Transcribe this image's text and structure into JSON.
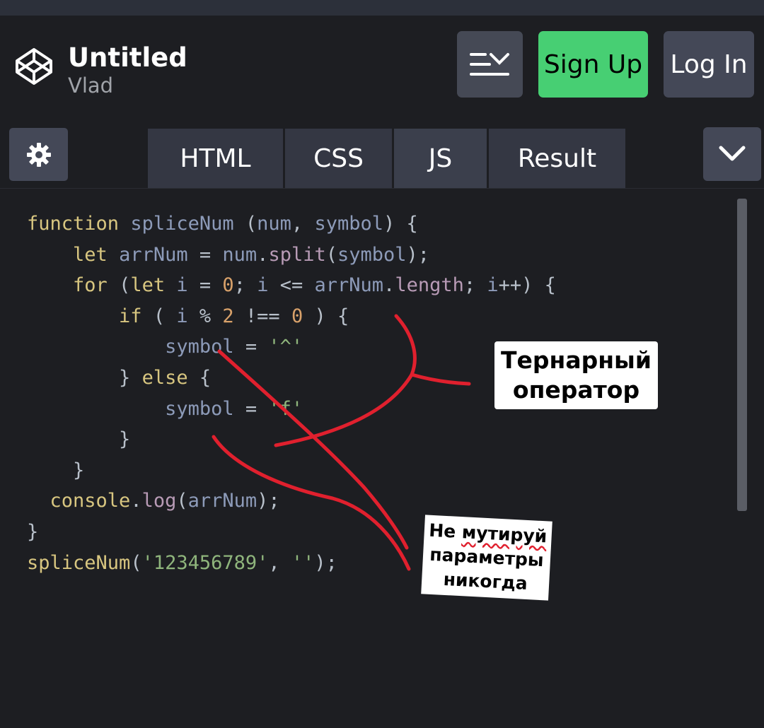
{
  "header": {
    "title": "Untitled",
    "author": "Vlad",
    "signup_label": "Sign Up",
    "login_label": "Log In",
    "layout_icon": "layout-toggle-icon",
    "logo_icon": "codepen-logo-icon"
  },
  "tabs": [
    {
      "label": "HTML"
    },
    {
      "label": "CSS"
    },
    {
      "label": "JS",
      "active": true
    },
    {
      "label": "Result"
    }
  ],
  "toolbar": {
    "settings_icon": "gear-icon",
    "collapse_icon": "chevron-down-icon"
  },
  "code": {
    "lines": [
      "function spliceNum (num, symbol) {",
      "    let arrNum = num.split(symbol);",
      "    for (let i = 0; i <= arrNum.length; i++) {",
      "        if ( i % 2 !== 0 ) {",
      "            symbol = '^'",
      "        } else {",
      "            symbol = 'f'",
      "        }",
      "    }",
      "  console.log(arrNum);",
      "}",
      "spliceNum('123456789', '');"
    ]
  },
  "annotations": {
    "note1_line1": "Тернарный",
    "note1_line2": "оператор",
    "note2_word1": "Не",
    "note2_word2": "мутируй",
    "note2_line2": "параметры",
    "note2_line3": "никогда"
  },
  "colors": {
    "signup": "#47cf73",
    "button": "#444857",
    "background": "#1d1e22",
    "ink": "#e0202e"
  }
}
